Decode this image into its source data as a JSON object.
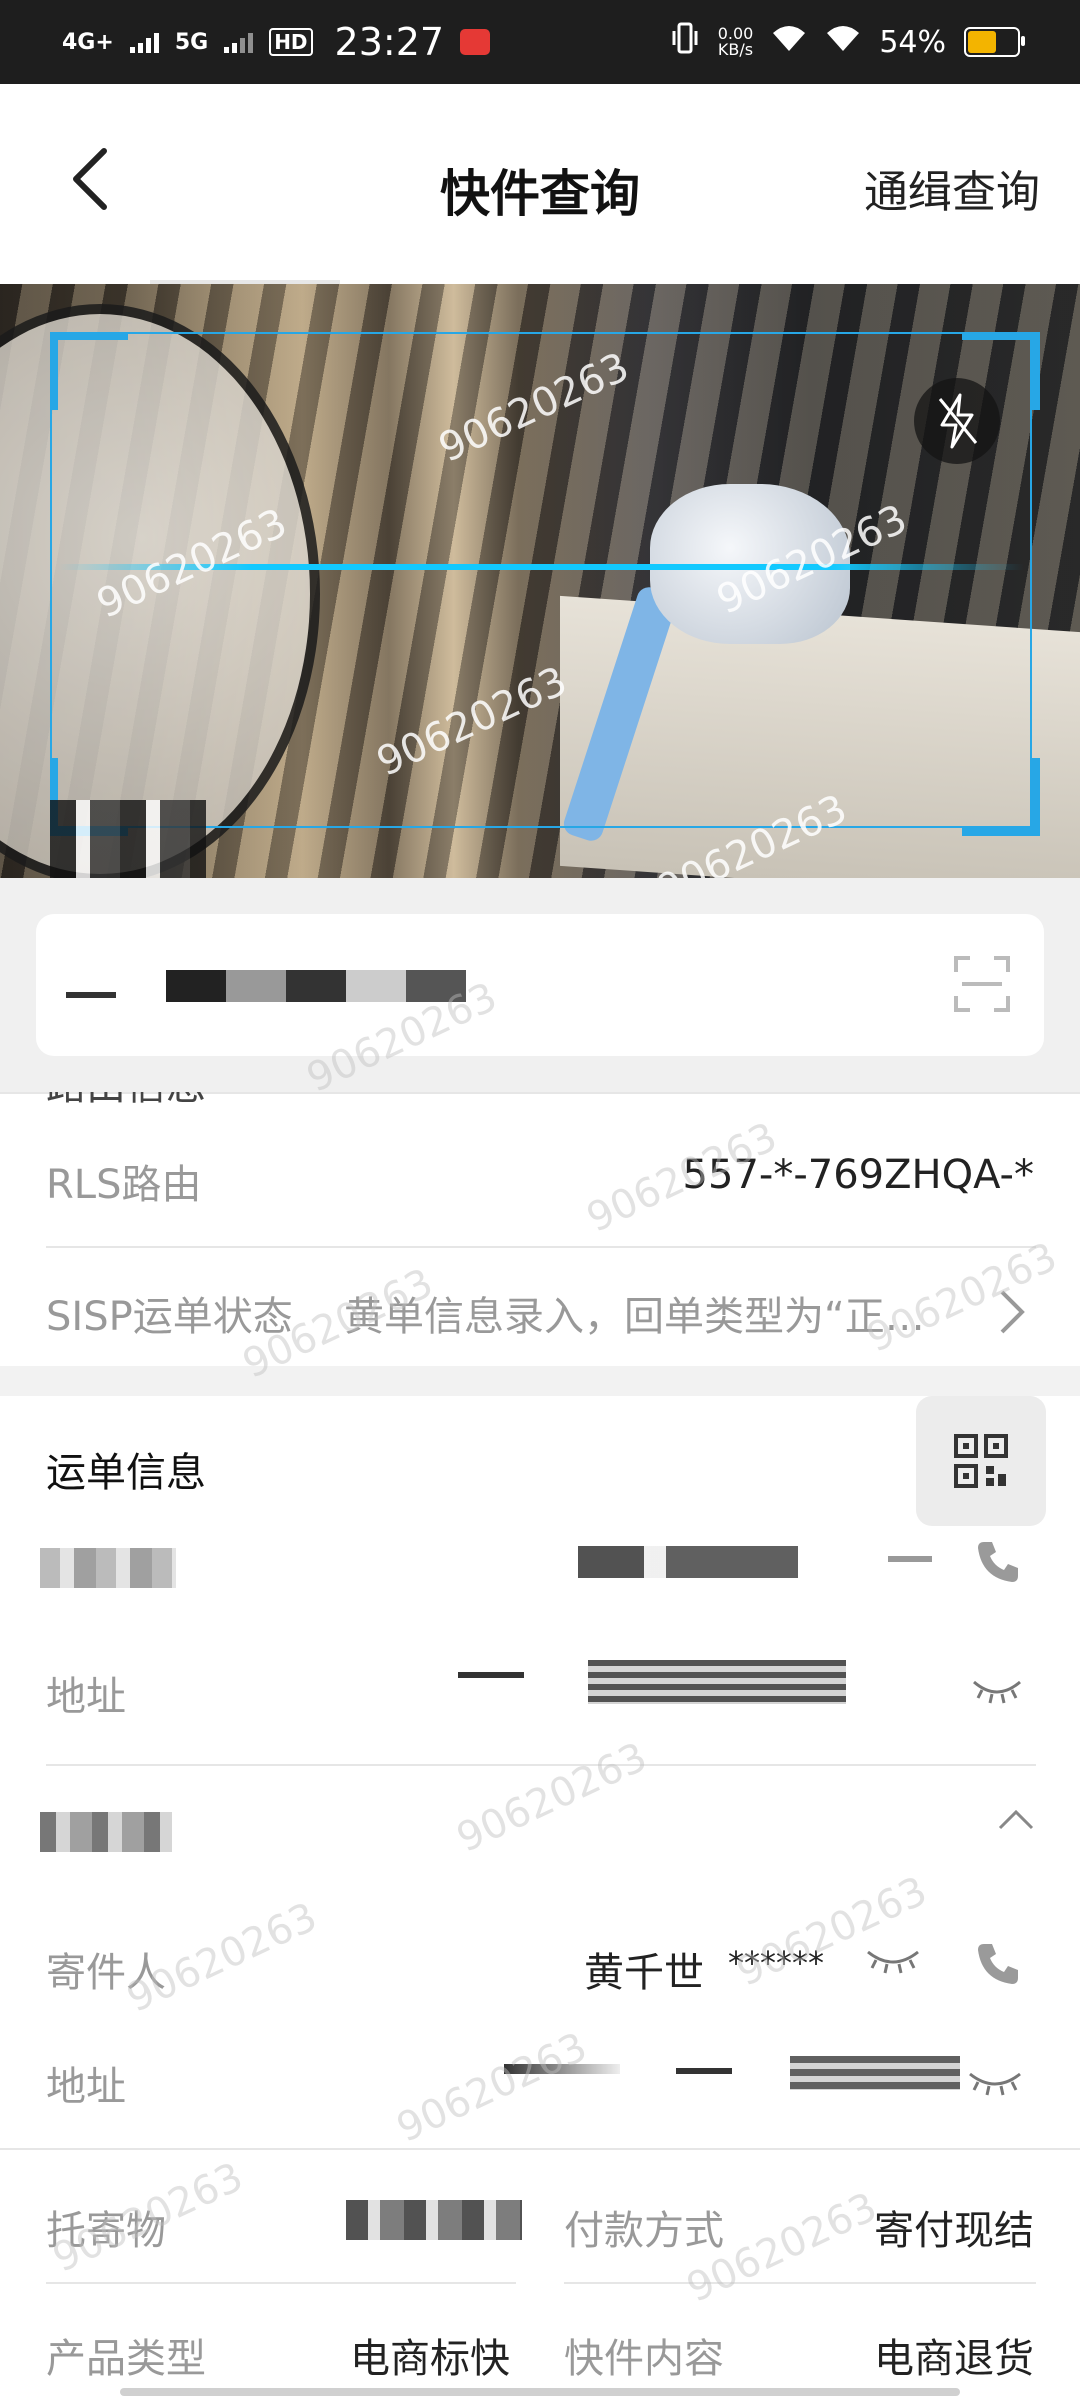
{
  "status_bar": {
    "network_1": "4G+",
    "network_2": "5G",
    "hd": "HD",
    "time": "23:27",
    "net_speed_value": "0.00",
    "net_speed_unit": "KB/s",
    "battery": "54%"
  },
  "header": {
    "title": "快件查询",
    "right_link": "通缉查询"
  },
  "routing": {
    "partial_heading": "路由信息",
    "rls_label": "RLS路由",
    "rls_value": "557-*-769ZHQA-*",
    "sisp_label": "SISP运单状态",
    "sisp_value": "黄单信息录入，回单类型为“正…"
  },
  "waybill": {
    "section_title": "运单信息",
    "recipient_address_label": "地址",
    "sender_label": "寄件人",
    "sender_name": "黄千世",
    "sender_phone_masked": "******",
    "sender_address_label": "地址",
    "consignment_label": "托寄物",
    "payment_label": "付款方式",
    "payment_value": "寄付现结",
    "product_type_label": "产品类型",
    "product_type_value": "电商标快",
    "content_label": "快件内容",
    "content_value": "电商退货"
  },
  "watermark": "90620263",
  "colors": {
    "scan_accent": "#27a7e6",
    "battery": "#f3b400"
  }
}
